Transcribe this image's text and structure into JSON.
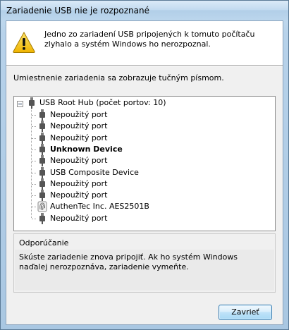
{
  "window": {
    "title": "Zariadenie USB nie je rozpoznané"
  },
  "header": {
    "icon": "warning-icon",
    "message": "Jedno zo zariadení USB pripojených k tomuto počítaču zlyhalo a systém Windows ho nerozpoznal."
  },
  "location_label": "Umiestnenie zariadenia sa zobrazuje tučným písmom.",
  "tree": {
    "root": {
      "label": "USB Root Hub (počet portov: 10)",
      "icon": "usb-plug-icon",
      "expanded": true
    },
    "children": [
      {
        "label": "Nepoužitý port",
        "icon": "usb-plug-icon",
        "bold": false
      },
      {
        "label": "Nepoužitý port",
        "icon": "usb-plug-icon",
        "bold": false
      },
      {
        "label": "Nepoužitý port",
        "icon": "usb-plug-icon",
        "bold": false
      },
      {
        "label": "Unknown Device",
        "icon": "usb-plug-icon",
        "bold": true
      },
      {
        "label": "Nepoužitý port",
        "icon": "usb-plug-icon",
        "bold": false
      },
      {
        "label": "USB Composite Device",
        "icon": "usb-plug-icon",
        "bold": false
      },
      {
        "label": "Nepoužitý port",
        "icon": "usb-plug-icon",
        "bold": false
      },
      {
        "label": "Nepoužitý port",
        "icon": "usb-plug-icon",
        "bold": false
      },
      {
        "label": "AuthenTec Inc. AES2501B",
        "icon": "fingerprint-icon",
        "bold": false
      },
      {
        "label": "Nepoužitý port",
        "icon": "usb-plug-icon",
        "bold": false
      }
    ]
  },
  "recommendation": {
    "title": "Odporúčanie",
    "text": "Skúste zariadenie znova pripojiť. Ak ho systém Windows naďalej nerozpoznáva, zariadenie vymeňte."
  },
  "buttons": {
    "close_label": "Zavrieť"
  },
  "colors": {
    "title_bar": "#c3dbf0",
    "warning": "#f5c311",
    "button_border": "#3c7fb1"
  }
}
